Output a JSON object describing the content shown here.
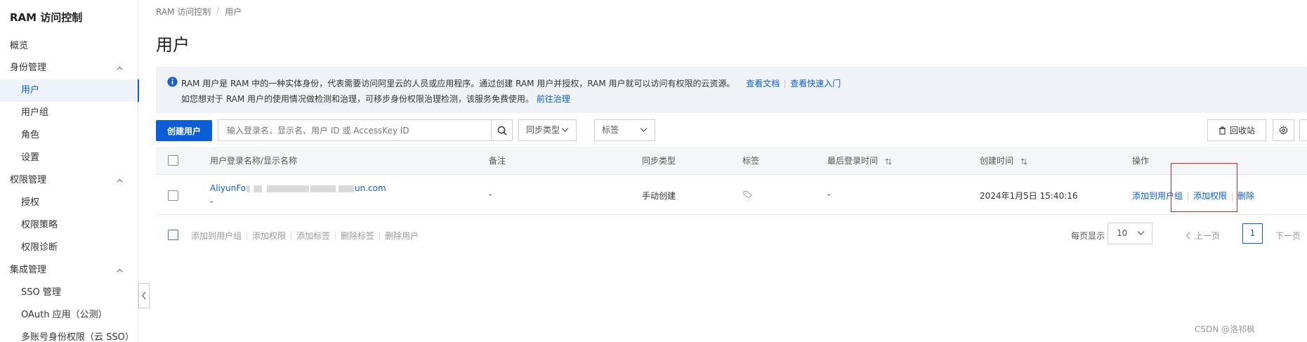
{
  "sidebar": {
    "brand": "RAM 访问控制",
    "overview": "概览",
    "group_identity": "身份管理",
    "identity_items": [
      "用户",
      "用户组",
      "角色",
      "设置"
    ],
    "group_permission": "权限管理",
    "permission_items": [
      "授权",
      "权限策略",
      "权限诊断"
    ],
    "group_integration": "集成管理",
    "integration_items": [
      "SSO 管理",
      "OAuth 应用（公测）",
      "多账号身份权限（云 SSO）"
    ]
  },
  "breadcrumb": [
    "RAM 访问控制",
    "用户"
  ],
  "page_title": "用户",
  "notice": {
    "line1": "RAM 用户是 RAM 中的一种实体身份，代表需要访问阿里云的人员或应用程序。通过创建 RAM 用户并授权，RAM 用户就可以访问有权限的云资源。",
    "link_docs": "查看文档",
    "link_quickstart": "查看快速入门",
    "line2": "如您想对于 RAM 用户的使用情况做检测和治理，可移步身份权限治理检测，该服务免费使用。",
    "link_governance": "前往治理"
  },
  "toolbar": {
    "create_label": "创建用户",
    "search_placeholder": "输入登录名、显示名、用户 ID 或 AccessKey ID",
    "sync_type_label": "同步类型",
    "tag_label": "标签",
    "recycle_label": "回收站"
  },
  "table": {
    "columns": [
      "用户登录名称/显示名称",
      "备注",
      "同步类型",
      "标签",
      "最后登录时间",
      "创建时间",
      "操作"
    ],
    "rows": [
      {
        "login_prefix": "AliyunFo",
        "login_suffix": "un.com",
        "display_name": "-",
        "remark": "-",
        "sync_type": "手动创建",
        "last_login": "-",
        "created": "2024年1月5日 15:40:16",
        "actions": [
          "添加到用户组",
          "添加权限",
          "删除"
        ]
      }
    ]
  },
  "bulk_actions": [
    "添加到用户组",
    "添加权限",
    "添加标签",
    "删除标签",
    "删除用户"
  ],
  "pagination": {
    "per_page_label": "每页显示",
    "per_page_value": "10",
    "prev_label": "上一页",
    "current_page": "1",
    "next_label": "下一页"
  },
  "watermark": "CSDN @洛祁枫",
  "colors": {
    "accent": "#0b5ed7",
    "highlight_border": "#e02020"
  }
}
